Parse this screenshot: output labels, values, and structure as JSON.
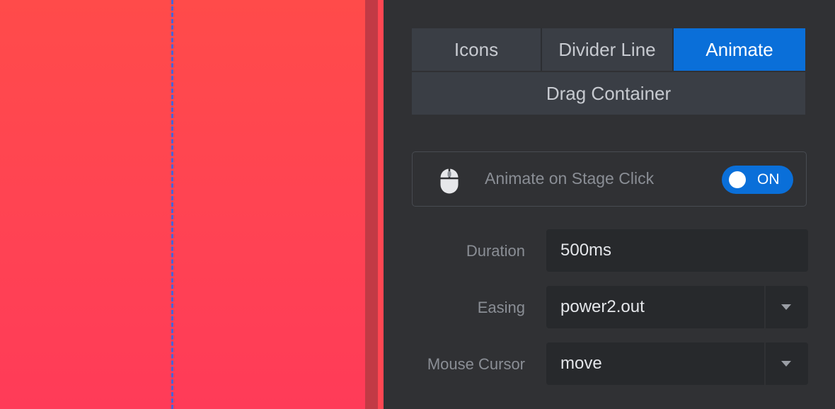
{
  "tabs": [
    {
      "label": "Icons",
      "active": false
    },
    {
      "label": "Divider Line",
      "active": false
    },
    {
      "label": "Animate",
      "active": true
    },
    {
      "label": "Drag Container",
      "active": false
    }
  ],
  "stage_click": {
    "icon": "mouse-icon",
    "label": "Animate on Stage Click",
    "toggle_text": "ON",
    "enabled": true
  },
  "duration": {
    "label": "Duration",
    "value": "500ms"
  },
  "easing": {
    "label": "Easing",
    "value": "power2.out"
  },
  "mouse_cursor": {
    "label": "Mouse Cursor",
    "value": "move"
  },
  "colors": {
    "accent": "#0a6fd9",
    "panel_bg": "#303134",
    "canvas_top": "#ff4b4a",
    "canvas_bottom": "#ff3b58",
    "dashed_line": "#4a63d6"
  }
}
